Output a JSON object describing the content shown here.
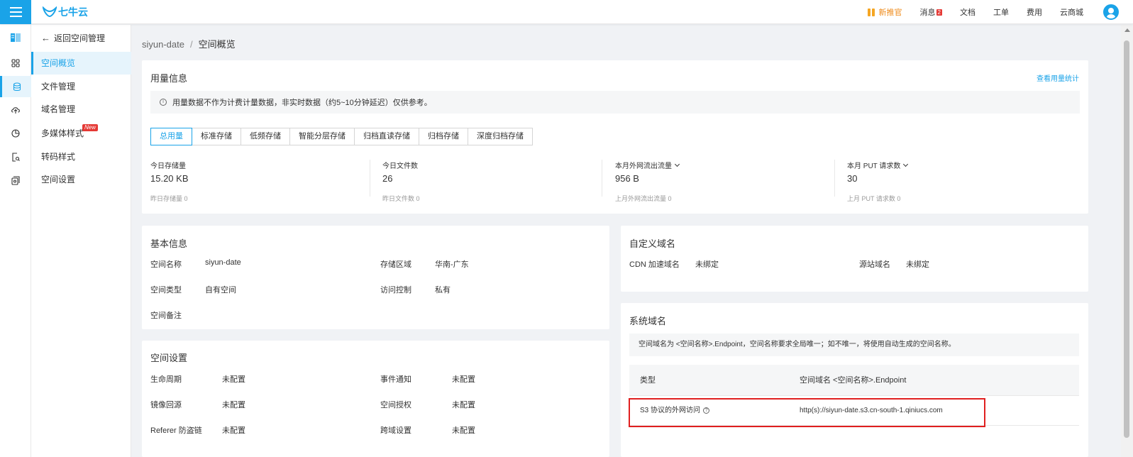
{
  "topbar": {
    "logo_text": "七牛云",
    "items": [
      {
        "label": "新推官",
        "name": "promo-link"
      },
      {
        "label": "消息",
        "name": "messages-link",
        "badge": "2"
      },
      {
        "label": "文档",
        "name": "docs-link"
      },
      {
        "label": "工单",
        "name": "ticket-link"
      },
      {
        "label": "费用",
        "name": "billing-link"
      },
      {
        "label": "云商城",
        "name": "marketplace-link"
      }
    ]
  },
  "rail": {
    "icons": [
      "kodo-brand-icon",
      "grid-icon",
      "database-icon",
      "cloud-upload-icon",
      "pie-chart-icon",
      "file-search-icon",
      "settings-doc-icon",
      "collapse-menu-icon"
    ],
    "active_index": 2
  },
  "subnav": {
    "back": "返回空间管理",
    "items": [
      "空间概览",
      "文件管理",
      "域名管理",
      "多媒体样式",
      "转码样式",
      "空间设置"
    ],
    "new_badge": "New",
    "active_index": 0
  },
  "breadcrumb": {
    "parent": "siyun-date",
    "separator": "/",
    "current": "空间概览"
  },
  "usage": {
    "title": "用量信息",
    "link": "查看用量统计",
    "notice_icon": "i",
    "notice": "用量数据不作为计费计量数据，非实时数据（约5~10分钟延迟）仅供参考。",
    "tabs": [
      "总用量",
      "标准存储",
      "低频存储",
      "智能分层存储",
      "归档直读存储",
      "归档存储",
      "深度归档存储"
    ],
    "active_tab": 0,
    "stats": [
      {
        "label": "今日存储量",
        "value": "15.20 KB",
        "prev": "昨日存储量 0",
        "dropdown": false
      },
      {
        "label": "今日文件数",
        "value": "26",
        "prev": "昨日文件数 0",
        "dropdown": false
      },
      {
        "label": "本月外网流出流量",
        "value": "956 B",
        "prev": "上月外网流出流量 0",
        "dropdown": true
      },
      {
        "label": "本月 PUT 请求数",
        "value": "30",
        "prev": "上月 PUT 请求数 0",
        "dropdown": true
      }
    ]
  },
  "basic": {
    "title": "基本信息",
    "rows": [
      {
        "k1": "空间名称",
        "v1": "siyun-date",
        "k2": "存储区域",
        "v2": "华南-广东"
      },
      {
        "k1": "空间类型",
        "v1": "自有空间",
        "k2": "访问控制",
        "v2": "私有"
      },
      {
        "k1": "空间备注",
        "v1": "",
        "k2": "",
        "v2": ""
      }
    ]
  },
  "spaceset": {
    "title": "空间设置",
    "rows": [
      {
        "k1": "生命周期",
        "v1": "未配置",
        "k2": "事件通知",
        "v2": "未配置"
      },
      {
        "k1": "镜像回源",
        "v1": "未配置",
        "k2": "空间授权",
        "v2": "未配置"
      },
      {
        "k1": "Referer 防盗链",
        "v1": "未配置",
        "k2": "跨域设置",
        "v2": "未配置"
      }
    ]
  },
  "customdom": {
    "title": "自定义域名",
    "cdn_label": "CDN 加速域名",
    "cdn_value": "未绑定",
    "origin_label": "源站域名",
    "origin_value": "未绑定"
  },
  "sysdom": {
    "title": "系统域名",
    "notice": "空间域名为 <空间名称>.Endpoint，空间名称要求全局唯一；如不唯一，将使用自动生成的空间名称。",
    "col_type": "类型",
    "col_domain": "空间域名 <空间名称>.Endpoint",
    "help_glyph": "?",
    "row_type": "S3 协议的外网访问",
    "row_domain": "http(s)://siyun-date.s3.cn-south-1.qiniucs.com"
  }
}
